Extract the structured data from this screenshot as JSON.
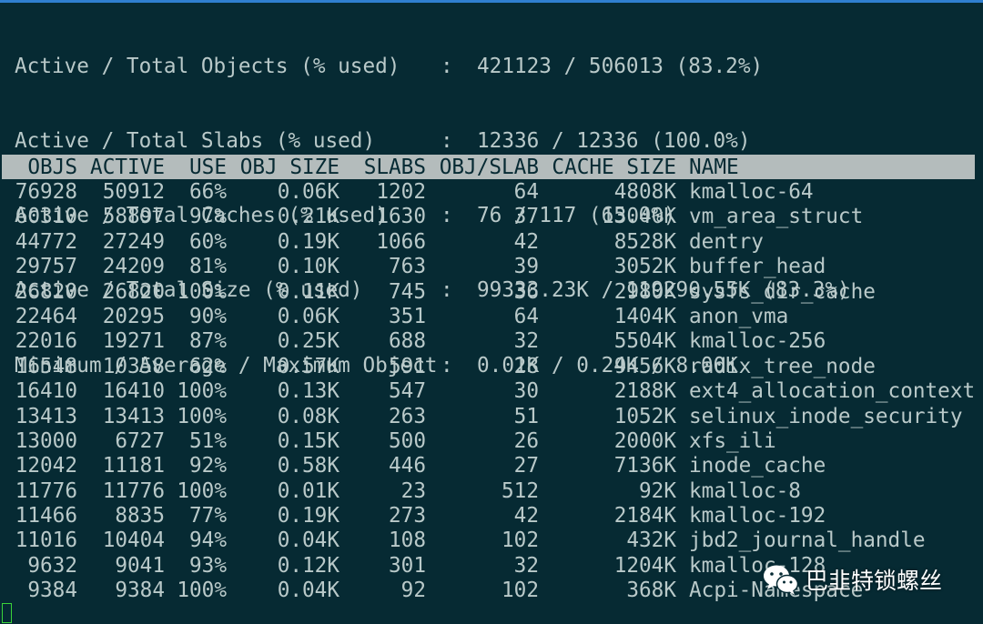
{
  "summary": [
    {
      "label": "Active / Total Objects (% used)",
      "value": "421123 / 506013 (83.2%)"
    },
    {
      "label": "Active / Total Slabs (% used)",
      "value": "12336 / 12336 (100.0%)"
    },
    {
      "label": "Active / Total Caches (% used)",
      "value": "76 / 117 (65.0%)"
    },
    {
      "label": "Active / Total Size (% used)",
      "value": "99333.23K / 119290.55K (83.3%)"
    },
    {
      "label": "Minimum / Average / Maximum Object",
      "value": "0.01K / 0.24K / 8.00K"
    }
  ],
  "separator": ":",
  "columns": {
    "objs": "OBJS",
    "active": "ACTIVE",
    "use": "USE",
    "obj_size": "OBJ SIZE",
    "slabs": "SLABS",
    "obj_slab": "OBJ/SLAB",
    "cache_size": "CACHE SIZE",
    "name": "NAME"
  },
  "rows": [
    {
      "objs": "76928",
      "active": "50912",
      "use": "66%",
      "obj_size": "0.06K",
      "slabs": "1202",
      "obj_slab": "64",
      "cache_size": "4808K",
      "name": "kmalloc-64"
    },
    {
      "objs": "60310",
      "active": "58897",
      "use": "97%",
      "obj_size": "0.21K",
      "slabs": "1630",
      "obj_slab": "37",
      "cache_size": "13040K",
      "name": "vm_area_struct"
    },
    {
      "objs": "44772",
      "active": "27249",
      "use": "60%",
      "obj_size": "0.19K",
      "slabs": "1066",
      "obj_slab": "42",
      "cache_size": "8528K",
      "name": "dentry"
    },
    {
      "objs": "29757",
      "active": "24209",
      "use": "81%",
      "obj_size": "0.10K",
      "slabs": "763",
      "obj_slab": "39",
      "cache_size": "3052K",
      "name": "buffer_head"
    },
    {
      "objs": "26820",
      "active": "26820",
      "use": "100%",
      "obj_size": "0.11K",
      "slabs": "745",
      "obj_slab": "36",
      "cache_size": "2980K",
      "name": "sysfs_dir_cache"
    },
    {
      "objs": "22464",
      "active": "20295",
      "use": "90%",
      "obj_size": "0.06K",
      "slabs": "351",
      "obj_slab": "64",
      "cache_size": "1404K",
      "name": "anon_vma"
    },
    {
      "objs": "22016",
      "active": "19271",
      "use": "87%",
      "obj_size": "0.25K",
      "slabs": "688",
      "obj_slab": "32",
      "cache_size": "5504K",
      "name": "kmalloc-256"
    },
    {
      "objs": "16548",
      "active": "10358",
      "use": "62%",
      "obj_size": "0.57K",
      "slabs": "591",
      "obj_slab": "28",
      "cache_size": "9456K",
      "name": "radix_tree_node"
    },
    {
      "objs": "16410",
      "active": "16410",
      "use": "100%",
      "obj_size": "0.13K",
      "slabs": "547",
      "obj_slab": "30",
      "cache_size": "2188K",
      "name": "ext4_allocation_context"
    },
    {
      "objs": "13413",
      "active": "13413",
      "use": "100%",
      "obj_size": "0.08K",
      "slabs": "263",
      "obj_slab": "51",
      "cache_size": "1052K",
      "name": "selinux_inode_security"
    },
    {
      "objs": "13000",
      "active": "6727",
      "use": "51%",
      "obj_size": "0.15K",
      "slabs": "500",
      "obj_slab": "26",
      "cache_size": "2000K",
      "name": "xfs_ili"
    },
    {
      "objs": "12042",
      "active": "11181",
      "use": "92%",
      "obj_size": "0.58K",
      "slabs": "446",
      "obj_slab": "27",
      "cache_size": "7136K",
      "name": "inode_cache"
    },
    {
      "objs": "11776",
      "active": "11776",
      "use": "100%",
      "obj_size": "0.01K",
      "slabs": "23",
      "obj_slab": "512",
      "cache_size": "92K",
      "name": "kmalloc-8"
    },
    {
      "objs": "11466",
      "active": "8835",
      "use": "77%",
      "obj_size": "0.19K",
      "slabs": "273",
      "obj_slab": "42",
      "cache_size": "2184K",
      "name": "kmalloc-192"
    },
    {
      "objs": "11016",
      "active": "10404",
      "use": "94%",
      "obj_size": "0.04K",
      "slabs": "108",
      "obj_slab": "102",
      "cache_size": "432K",
      "name": "jbd2_journal_handle"
    },
    {
      "objs": "9632",
      "active": "9041",
      "use": "93%",
      "obj_size": "0.12K",
      "slabs": "301",
      "obj_slab": "32",
      "cache_size": "1204K",
      "name": "kmalloc-128"
    },
    {
      "objs": "9384",
      "active": "9384",
      "use": "100%",
      "obj_size": "0.04K",
      "slabs": "92",
      "obj_slab": "102",
      "cache_size": "368K",
      "name": "Acpi-Namespace"
    }
  ],
  "watermark": {
    "text": "巴韭特锁螺丝",
    "icon": "wechat-icon"
  },
  "colors": {
    "background": "#062a33",
    "text": "#b9c9c9",
    "header_bar": "#b4bcbc",
    "cursor": "#3ad33a",
    "top_line": "#2f7fd0"
  }
}
